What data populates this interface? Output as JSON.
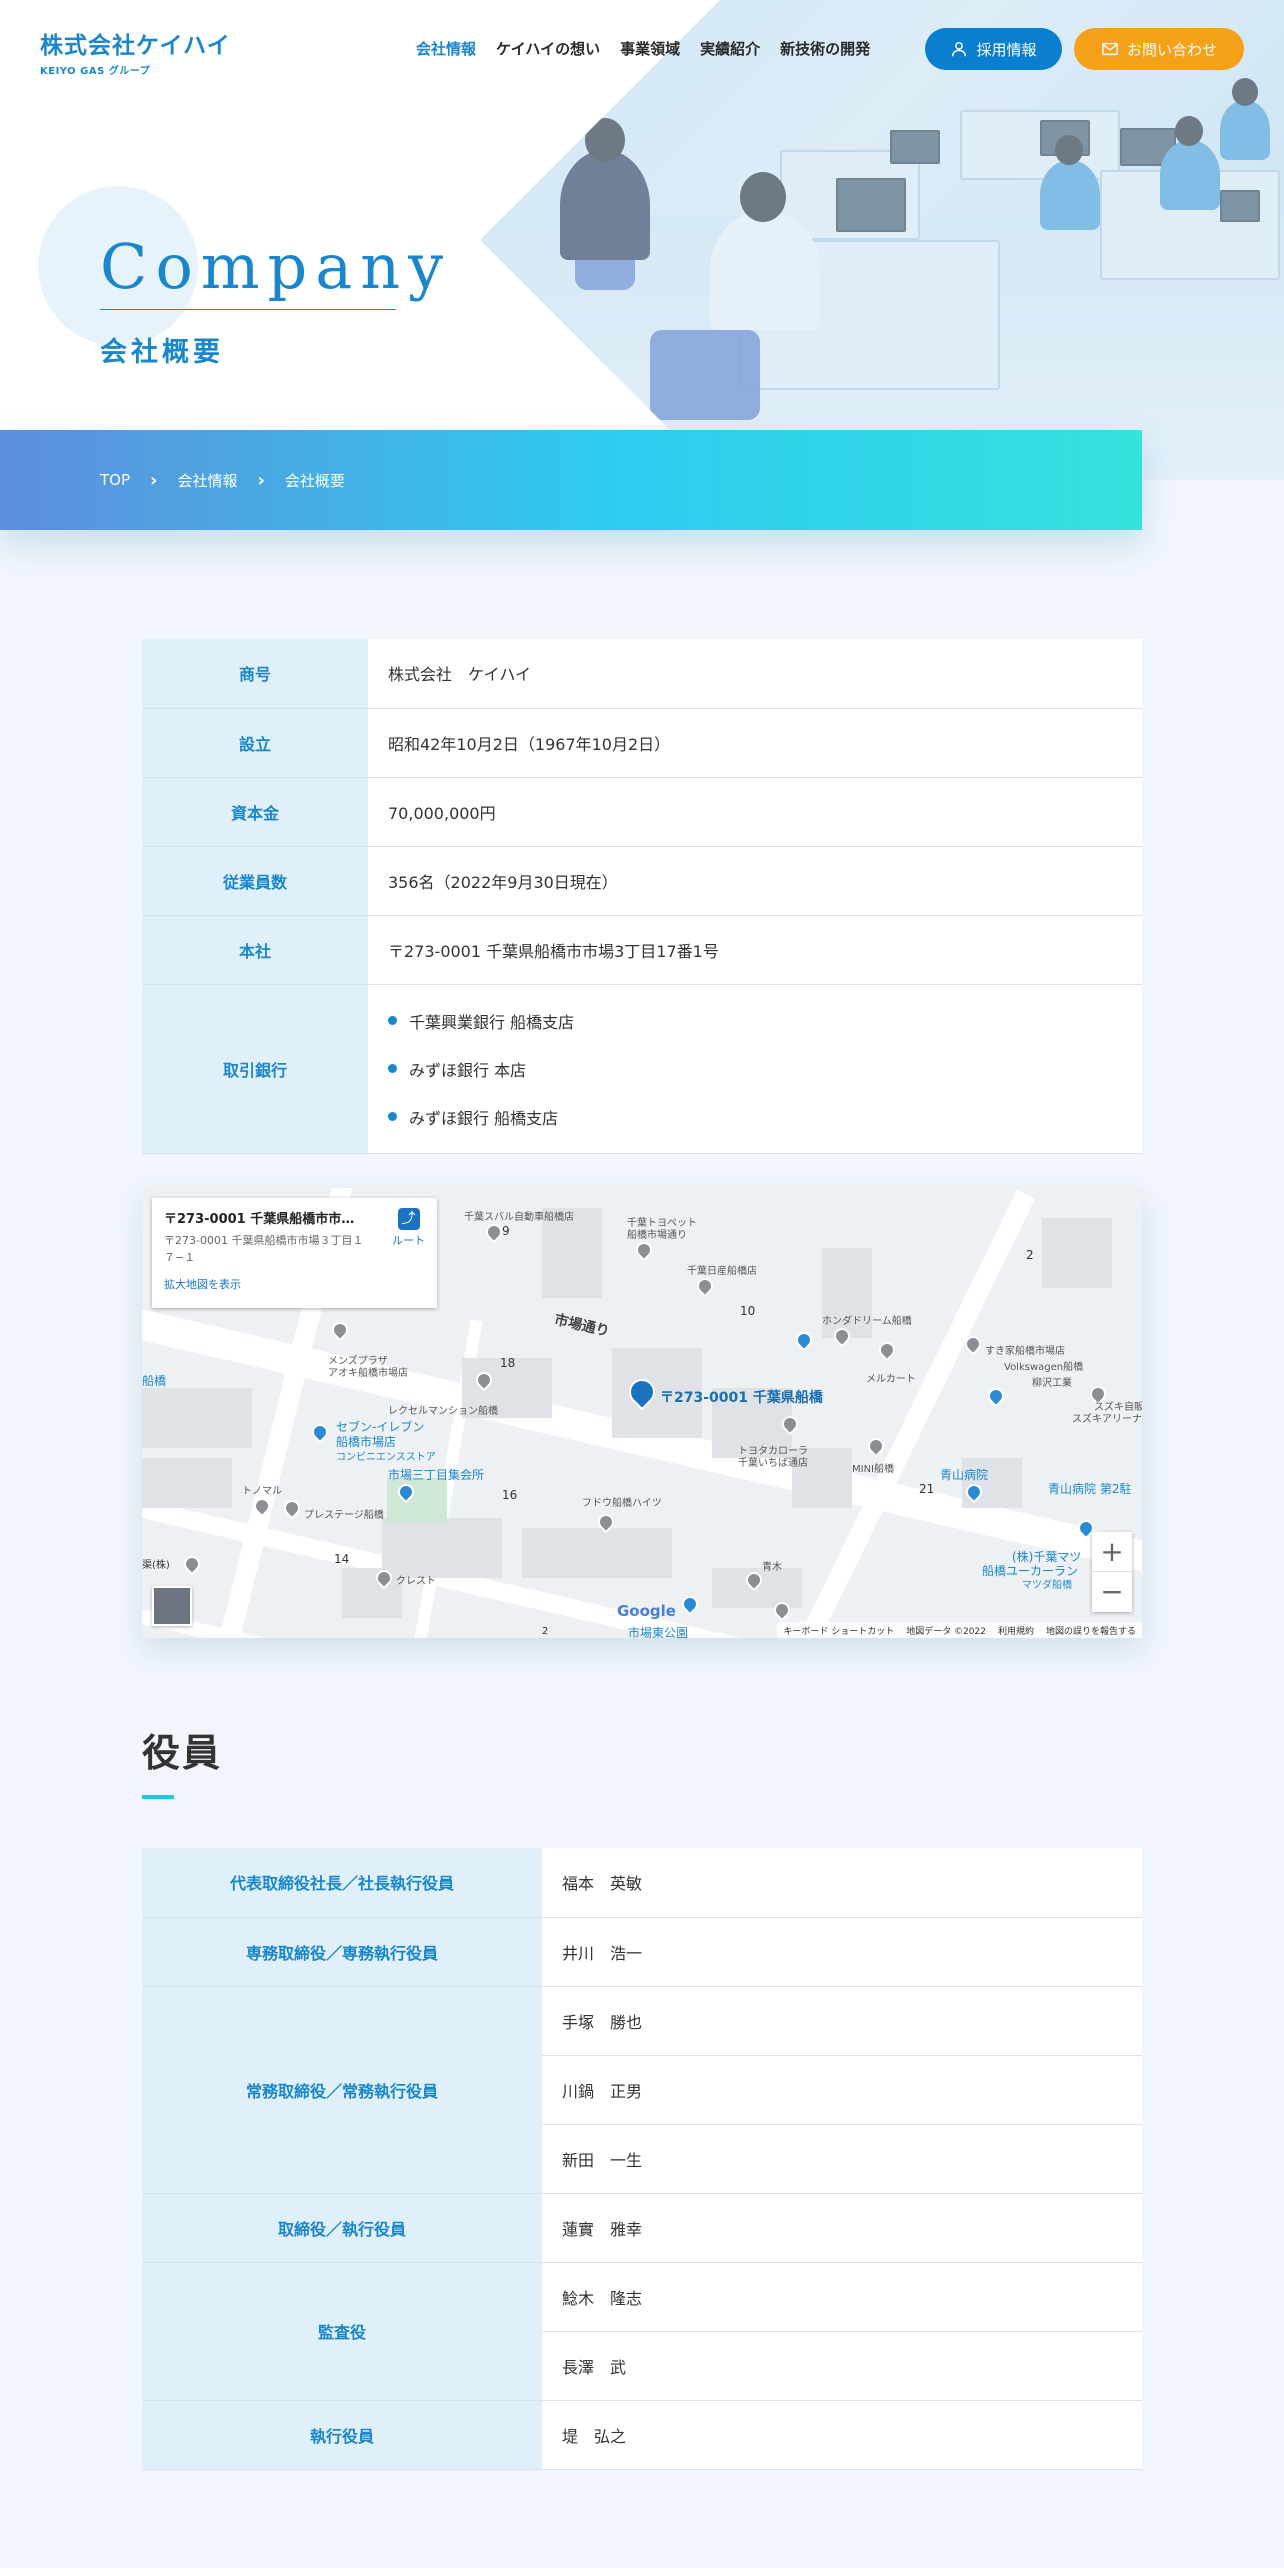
{
  "header": {
    "logo_main": "株式会社ケイハイ",
    "logo_sub": "KEIYO GAS グループ",
    "nav": [
      {
        "label": "会社情報",
        "active": true
      },
      {
        "label": "ケイハイの想い"
      },
      {
        "label": "事業領域"
      },
      {
        "label": "実績紹介"
      },
      {
        "label": "新技術の開発"
      }
    ],
    "recruit_label": "採用情報",
    "contact_label": "お問い合わせ"
  },
  "hero": {
    "title_en": "Company",
    "title_ja": "会社概要"
  },
  "breadcrumb": [
    "TOP",
    "会社情報",
    "会社概要"
  ],
  "company": {
    "rows": [
      {
        "label": "商号",
        "value": "株式会社　ケイハイ"
      },
      {
        "label": "設立",
        "value": "昭和42年10月2日（1967年10月2日）"
      },
      {
        "label": "資本金",
        "value": "70,000,000円"
      },
      {
        "label": "従業員数",
        "value": "356名（2022年9月30日現在）"
      },
      {
        "label": "本社",
        "value": "〒273-0001 千葉県船橋市市場3丁目17番1号"
      }
    ],
    "banks_label": "取引銀行",
    "banks": [
      "千葉興業銀行 船橋支店",
      "みずほ銀行 本店",
      "みずほ銀行 船橋支店"
    ]
  },
  "map": {
    "info_title": "〒273-0001 千葉県船橋市市場...",
    "info_address": "〒273-0001 千葉県船橋市市場３丁目１７−１",
    "info_link": "拡大地図を表示",
    "route_label": "ルート",
    "pin_label": "〒273-0001 千葉県船橋",
    "street": "市場通り",
    "labels": {
      "subaru": "千葉スバル自動車船橋店",
      "toyopet": "千葉トヨペット",
      "toyopet2": "船橋市場通り",
      "nissan": "千葉日産船橋店",
      "honda": "ホンダドリーム船橋",
      "mercart": "メルカート",
      "sukiya": "すき家船橋市場店",
      "vw": "Volkswagen船橋",
      "yanagisawa": "柳沢工業",
      "mens": "メンズプラザ",
      "mens2": "アオキ船橋市場店",
      "rexel": "レクセルマンション船橋",
      "seven": "セブン-イレブン",
      "seven2": "船橋市場店",
      "seven3": "コンビニエンスストア",
      "kaikan": "市場三丁目集会所",
      "toyota": "トヨタカローラ",
      "toyota2": "千葉いちば通店",
      "mini": "MINI船橋",
      "aoyama": "青山病院",
      "aoyama2": "青山病院 第2駐",
      "fudow": "フドウ船橋ハイツ",
      "tonomaru": "トノマル",
      "prestige": "プレステージ船橋",
      "crest": "クレスト",
      "aoki": "青木",
      "park": "市場東公園",
      "chiba_mart": "(株)千葉マツ",
      "eucalyptus": "船橋ユーカーラン",
      "mazda": "マツダ船橋",
      "suzuki": "スズキ自販",
      "suzuki2": "スズキアリーナ",
      "funabashi": "船橋",
      "kabu": "渠(株)",
      "n2": "2",
      "n9": "9",
      "n10": "10",
      "n18": "18",
      "n16": "16",
      "n14": "14",
      "n21": "21",
      "n2b": "2"
    },
    "attribution": [
      "キーボード ショートカット",
      "地図データ ©2022",
      "利用規約",
      "地図の誤りを報告する"
    ],
    "google": "Google"
  },
  "officers": {
    "title": "役員",
    "groups": [
      {
        "role": "代表取締役社長／社長執行役員",
        "names": [
          "福本　英敏"
        ]
      },
      {
        "role": "専務取締役／専務執行役員",
        "names": [
          "井川　浩一"
        ]
      },
      {
        "role": "常務取締役／常務執行役員",
        "names": [
          "手塚　勝也",
          "川鍋　正男",
          "新田　一生"
        ]
      },
      {
        "role": "取締役／執行役員",
        "names": [
          "蓮實　雅幸"
        ]
      },
      {
        "role": "監査役",
        "names": [
          "鯰木　隆志",
          "長澤　武"
        ]
      },
      {
        "role": "執行役員",
        "names": [
          "堤　弘之"
        ]
      }
    ]
  },
  "colors": {
    "brand": "#1a86cc",
    "recruit": "#0a7fd0",
    "contact": "#f5a11a",
    "th_bg": "#dff0fa"
  }
}
